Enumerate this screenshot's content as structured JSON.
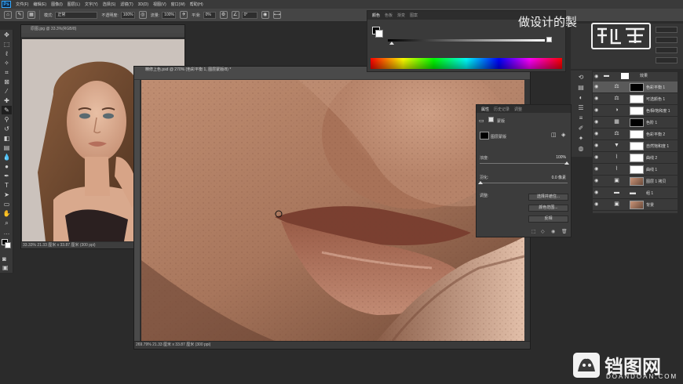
{
  "app": {
    "logo": "Ps",
    "menu": [
      "文件(F)",
      "编辑(E)",
      "图像(I)",
      "图层(L)",
      "文字(Y)",
      "选择(S)",
      "滤镜(T)",
      "3D(D)",
      "视图(V)",
      "窗口(W)",
      "帮助(H)"
    ]
  },
  "options": {
    "mode_label": "模式:",
    "mode_value": "正常",
    "opacity_label": "不透明度:",
    "opacity_value": "100%",
    "flow_label": "流量:",
    "flow_value": "100%",
    "smooth_label": "平滑:",
    "smooth_value": "0%",
    "angle_value": "0°"
  },
  "tools": [
    "move",
    "marquee",
    "lasso",
    "quick-select",
    "crop",
    "eyedropper",
    "spot-heal",
    "brush",
    "clone-stamp",
    "history-brush",
    "eraser",
    "gradient",
    "blur",
    "dodge",
    "pen",
    "type",
    "path-select",
    "rectangle",
    "hand",
    "zoom"
  ],
  "doc1": {
    "tab_title": "原图.jpg @ 33.3%(RGB/8)",
    "status": "33.33%   21.33 厘米 x 33.87 厘米 (300 ppi)"
  },
  "doc2": {
    "tab_title": "精修上色.psd @ 270% (色彩平衡 1, 图层蒙版/8) *",
    "status": "269.79%   21.33 厘米 x 33.87 厘米 (300 ppi)"
  },
  "color_panel": {
    "tabs": [
      "颜色",
      "色板",
      "渐变",
      "图案"
    ],
    "active_tab": 0,
    "foreground": "#000000",
    "background": "#ffffff"
  },
  "properties": {
    "tabs": [
      "属性",
      "历史记录",
      "调整"
    ],
    "header_label": "蒙版",
    "mask_type": "图层蒙版",
    "density_label": "浓度:",
    "density_value": "100%",
    "feather_label": "羽化:",
    "feather_value": "0.0 像素",
    "refine_label": "调整:",
    "btn_select_mask": "选择并遮住...",
    "btn_color_range": "颜色范围...",
    "btn_invert": "反相"
  },
  "layers": [
    {
      "name": "色彩平衡 1",
      "selected": true,
      "thumb": "black"
    },
    {
      "name": "可选颜色 1",
      "selected": false,
      "thumb": "white"
    },
    {
      "name": "色相/饱和度 1",
      "selected": false,
      "thumb": "white"
    },
    {
      "name": "色阶 1",
      "selected": false,
      "thumb": "black"
    },
    {
      "name": "色彩平衡 2",
      "selected": false,
      "thumb": "white"
    },
    {
      "name": "自然饱和度 1",
      "selected": false,
      "thumb": "white"
    },
    {
      "name": "曲线 2",
      "selected": false,
      "thumb": "white"
    },
    {
      "name": "曲线 1",
      "selected": false,
      "thumb": "white"
    },
    {
      "name": "图层 1 拷贝",
      "selected": false,
      "thumb": "photo"
    },
    {
      "name": "组 1",
      "selected": false,
      "thumb": "folder"
    },
    {
      "name": "背景",
      "selected": false,
      "thumb": "photo"
    }
  ],
  "watermarks": {
    "channel_text": "做设计的製",
    "site_cn": "铛图网",
    "site_en": "DOANDOAN.COM"
  }
}
